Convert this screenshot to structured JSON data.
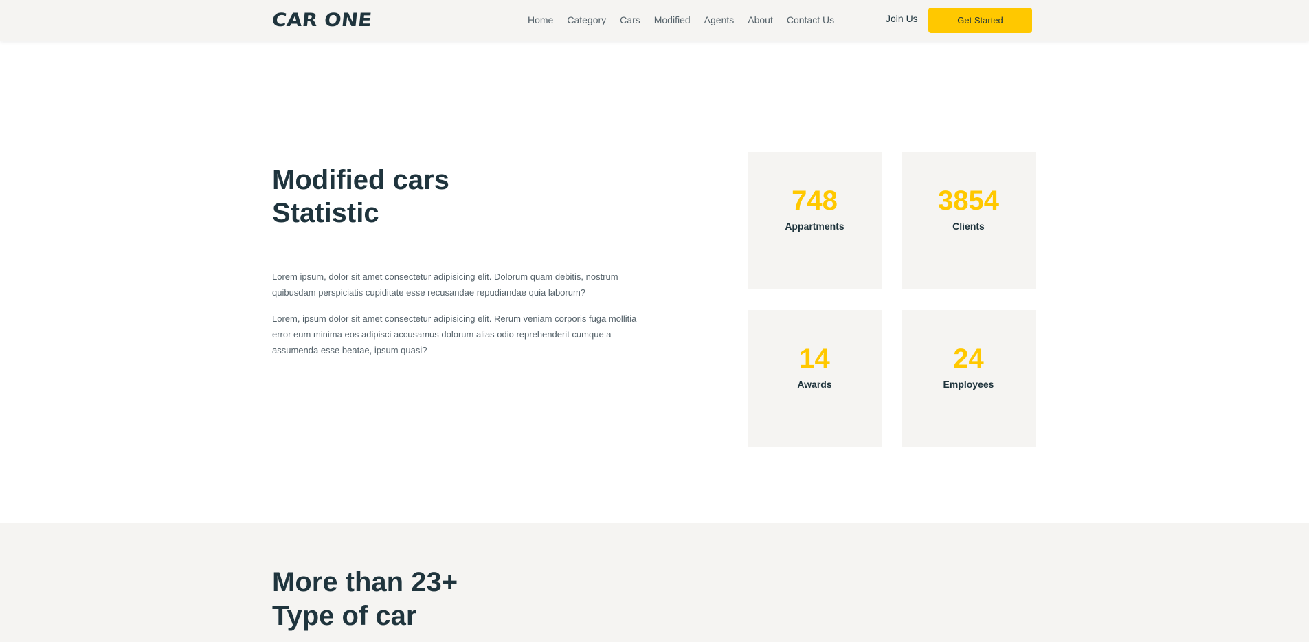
{
  "header": {
    "logo": "CAR ONE",
    "nav": [
      "Home",
      "Category",
      "Cars",
      "Modified",
      "Agents",
      "About",
      "Contact Us"
    ],
    "join_label": "Join Us",
    "cta_label": "Get Started"
  },
  "stats": {
    "title_line1": "Modified cars",
    "title_line2": "Statistic",
    "paragraph1": "Lorem ipsum, dolor sit amet consectetur adipisicing elit. Dolorum quam debitis, nostrum quibusdam perspiciatis cupiditate esse recusandae repudiandae quia laborum?",
    "paragraph2": "Lorem, ipsum dolor sit amet consectetur adipisicing elit. Rerum veniam corporis fuga mollitia error eum minima eos adipisci accusamus dolorum alias odio reprehenderit cumque a assumenda esse beatae, ipsum quasi?",
    "cards": [
      {
        "value": "748",
        "label": "Appartments"
      },
      {
        "value": "3854",
        "label": "Clients"
      },
      {
        "value": "14",
        "label": "Awards"
      },
      {
        "value": "24",
        "label": "Employees"
      }
    ]
  },
  "types": {
    "title_line1": "More than 23+",
    "title_line2": "Type of car"
  },
  "colors": {
    "accent": "#ffc800",
    "text_dark": "#1f343d",
    "panel": "#f5f4f2"
  }
}
